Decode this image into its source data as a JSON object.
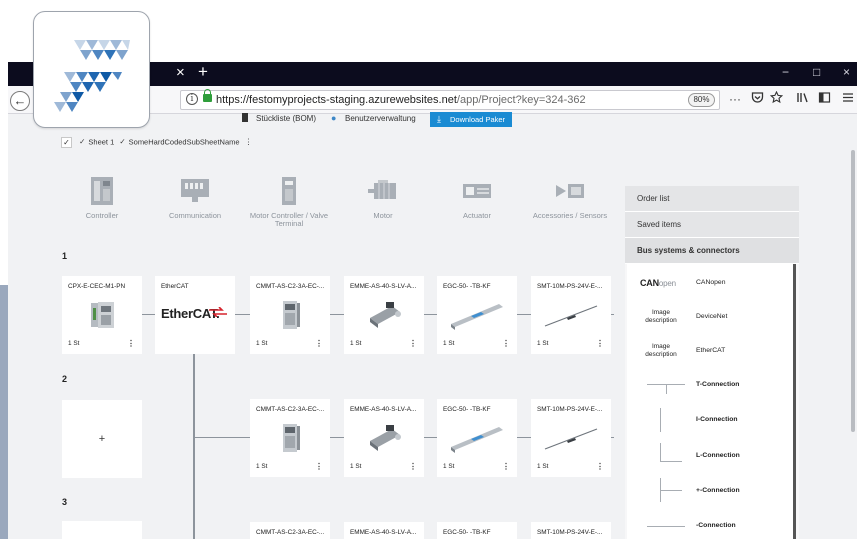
{
  "browser": {
    "tab_close": "×",
    "tab_new": "+",
    "win_min": "−",
    "win_max": "□",
    "win_close": "×",
    "back": "←",
    "url_host": "https://festomyprojects-staging.azurewebsites.net",
    "url_path": "/app/Project?key=324-362",
    "zoom": "80%",
    "menu_dots": "···",
    "info": "i"
  },
  "app": {
    "bom_label": "Stückliste (BOM)",
    "user_admin_label": "Benutzerverwaltung",
    "download_label": "Download Paker"
  },
  "sheets": [
    {
      "label": "Sheet 1",
      "checked": true
    },
    {
      "label": "SomeHardCodedSubSheetName",
      "checked": true
    }
  ],
  "sheet_menu": "⋮",
  "categories": [
    {
      "label": "Controller"
    },
    {
      "label": "Communication"
    },
    {
      "label": "Motor Controller / Valve Terminal"
    },
    {
      "label": "Motor"
    },
    {
      "label": "Actuator"
    },
    {
      "label": "Accessories / Sensors"
    }
  ],
  "rows": [
    {
      "number": "1"
    },
    {
      "number": "2"
    },
    {
      "number": "3"
    }
  ],
  "row1_cards": [
    {
      "title": "CPX-E-CEC-M1-PN",
      "qty": "1 St",
      "more": "⋮"
    },
    {
      "title": "EtherCAT",
      "logo": "EtherCAT."
    },
    {
      "title": "CMMT-AS-C2-3A-EC-...",
      "qty": "1 St",
      "more": "⋮"
    },
    {
      "title": "EMME-AS-40-S-LV-A...",
      "qty": "1 St",
      "more": "⋮"
    },
    {
      "title": "EGC-50- -TB-KF",
      "qty": "1 St",
      "more": "⋮"
    },
    {
      "title": "SMT-10M-PS-24V-E-...",
      "qty": "1 St",
      "more": "⋮"
    }
  ],
  "row2_cards": [
    {
      "title": "CMMT-AS-C2-3A-EC-...",
      "qty": "1 St",
      "more": "⋮"
    },
    {
      "title": "EMME-AS-40-S-LV-A...",
      "qty": "1 St",
      "more": "⋮"
    },
    {
      "title": "EGC-50- -TB-KF",
      "qty": "1 St",
      "more": "⋮"
    },
    {
      "title": "SMT-10M-PS-24V-E-...",
      "qty": "1 St",
      "more": "⋮"
    }
  ],
  "row3_titles": [
    "CMMT-AS-C2-3A-EC-...",
    "EMME-AS-40-S-LV-A...",
    "EGC-50- -TB-KF",
    "SMT-10M-PS-24V-E-..."
  ],
  "add_label": "+",
  "panel": {
    "tabs": [
      "Order list",
      "Saved items",
      "Bus systems & connectors"
    ],
    "canopen_logo_bold": "CAN",
    "canopen_logo_light": "open",
    "items": [
      {
        "label": "CANopen"
      },
      {
        "label": "DeviceNet",
        "thumb": "Image description"
      },
      {
        "label": "EtherCAT",
        "thumb": "Image description"
      },
      {
        "label": "T-Connection"
      },
      {
        "label": "I-Connection"
      },
      {
        "label": "L-Connection"
      },
      {
        "label": "+-Connection"
      },
      {
        "label": "-Connection"
      }
    ]
  },
  "colors": {
    "titlebar": "#0c0c1e",
    "accent": "#1a8bd3",
    "logo_blue": "#1a6fb5",
    "connector": "#8d949c"
  }
}
